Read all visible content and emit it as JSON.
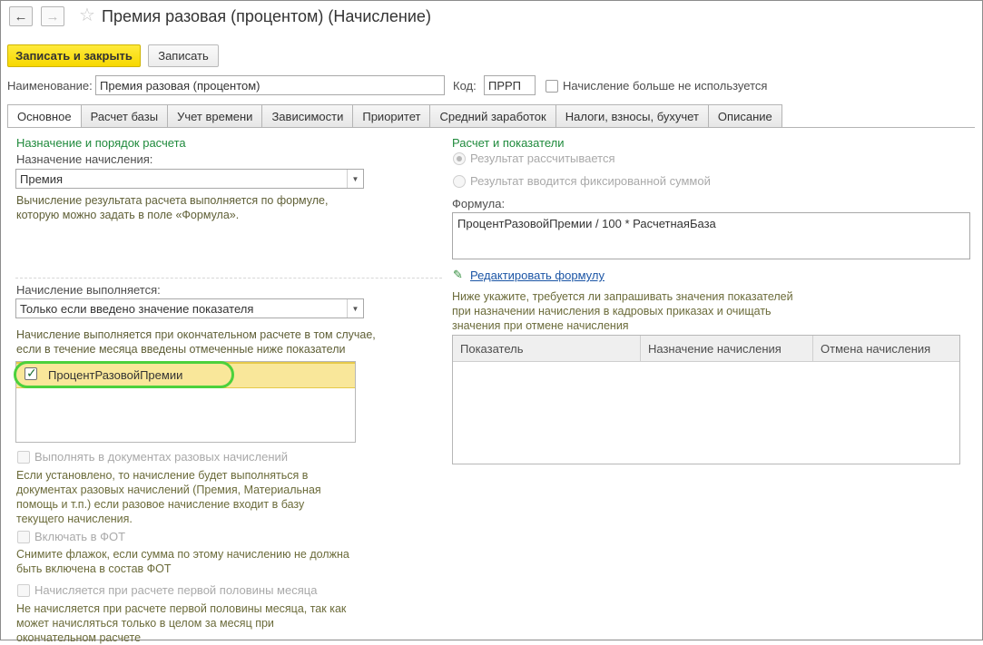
{
  "header": {
    "back_icon": "arrow-left-icon",
    "forward_icon": "arrow-right-icon",
    "favorite_icon": "star-icon",
    "title": "Премия разовая (процентом) (Начисление)"
  },
  "toolbar": {
    "save_close_label": "Записать и закрыть",
    "save_label": "Записать"
  },
  "fields": {
    "name_label": "Наименование:",
    "name_value": "Премия разовая (процентом)",
    "code_label": "Код:",
    "code_value": "ПРРП",
    "unused_label": "Начисление больше не используется"
  },
  "tabs": [
    "Основное",
    "Расчет базы",
    "Учет времени",
    "Зависимости",
    "Приоритет",
    "Средний заработок",
    "Налоги, взносы, бухучет",
    "Описание"
  ],
  "left": {
    "section_title": "Назначение и порядок расчета",
    "purpose_label": "Назначение начисления:",
    "purpose_value": "Премия",
    "purpose_hint": "Вычисление результата расчета выполняется по формуле, которую можно задать в поле «Формула».",
    "exec_label": "Начисление выполняется:",
    "exec_value": "Только если введено значение показателя",
    "exec_hint": "Начисление выполняется при окончательном расчете в том случае, если в течение месяца введены отмеченные ниже показатели",
    "indicator_item": "ПроцентРазовойПремии",
    "one_time_label": "Выполнять в документах разовых начислений",
    "one_time_hint": "Если установлено, то начисление будет выполняться в документах разовых начислений (Премия, Материальная помощь и т.п.) если разовое начисление входит в базу текущего начисления.",
    "fot_label": "Включать в ФОТ",
    "fot_hint": "Снимите флажок, если сумма по этому начислению не должна быть включена в состав ФОТ",
    "half_month_label": "Начисляется при расчете первой половины месяца",
    "half_month_hint": "Не начисляется при расчете первой половины месяца, так как может начисляться только в целом за месяц при окончательном расчете"
  },
  "right": {
    "section_title": "Расчет и показатели",
    "radio_calculated": "Результат рассчитывается",
    "radio_fixed": "Результат вводится фиксированной суммой",
    "formula_label": "Формула:",
    "formula_value": "ПроцентРазовойПремии / 100 * РасчетнаяБаза",
    "edit_formula_link": "Редактировать формулу",
    "indicators_hint": "Ниже укажите, требуется ли запрашивать значения показателей при назначении начисления в кадровых приказах и очищать значения при отмене начисления",
    "table_columns": [
      "Показатель",
      "Назначение начисления",
      "Отмена начисления"
    ]
  }
}
